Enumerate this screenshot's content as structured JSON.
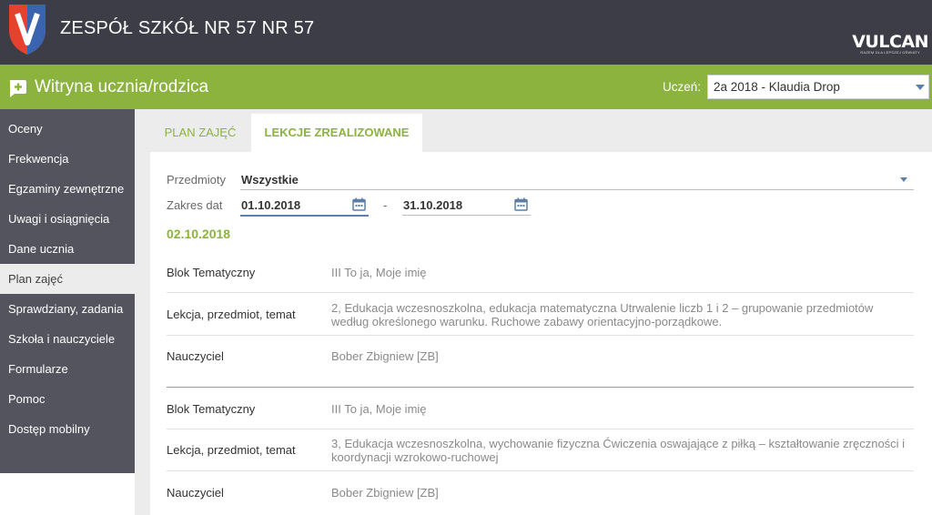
{
  "header": {
    "school_name": "ZESPÓŁ SZKÓŁ NR 57 NR 57",
    "vendor_logo": "VULCAN",
    "vendor_tagline": "RAZEM DLA LEPSZEJ OŚWIATY",
    "brand_color": "#8bb33e"
  },
  "app": {
    "title": "Witryna ucznia/rodzica",
    "student_label": "Uczeń:",
    "student_value": "2a 2018 - Klaudia Drop"
  },
  "sidebar": {
    "items": [
      {
        "label": "Oceny"
      },
      {
        "label": "Frekwencja"
      },
      {
        "label": "Egzaminy zewnętrzne"
      },
      {
        "label": "Uwagi i osiągnięcia"
      },
      {
        "label": "Dane ucznia"
      },
      {
        "label": "Plan zajęć",
        "active": true
      },
      {
        "label": "Sprawdziany, zadania"
      },
      {
        "label": "Szkoła i nauczyciele"
      },
      {
        "label": "Formularze"
      },
      {
        "label": "Pomoc"
      },
      {
        "label": "Dostęp mobilny"
      }
    ]
  },
  "tabs": [
    {
      "label": "PLAN ZAJĘĆ"
    },
    {
      "label": "LEKCJE ZREALIZOWANE",
      "active": true
    }
  ],
  "filters": {
    "subjects_label": "Przedmioty",
    "subjects_value": "Wszystkie",
    "date_range_label": "Zakres dat",
    "date_from": "01.10.2018",
    "date_separator": "-",
    "date_to": "31.10.2018"
  },
  "day": {
    "date": "02.10.2018",
    "lessons": [
      {
        "block_label": "Blok Tematyczny",
        "block_value": "III To ja, Moje imię",
        "lesson_label": "Lekcja, przedmiot, temat",
        "lesson_value": "2, Edukacja wczesnoszkolna, edukacja matematyczna Utrwalenie liczb 1 i 2 – grupowanie przedmiotów według określonego warunku. Ruchowe zabawy orientacyjno-porządkowe.",
        "teacher_label": "Nauczyciel",
        "teacher_value": "Bober Zbigniew [ZB]"
      },
      {
        "block_label": "Blok Tematyczny",
        "block_value": "III To ja, Moje imię",
        "lesson_label": "Lekcja, przedmiot, temat",
        "lesson_value": "3, Edukacja wczesnoszkolna, wychowanie fizyczna Ćwiczenia oswajające z piłką – kształtowanie zręczności i koordynacji wzrokowo-ruchowej",
        "teacher_label": "Nauczyciel",
        "teacher_value": "Bober Zbigniew [ZB]"
      }
    ]
  },
  "icons": {
    "school_crest": "shield-v-icon",
    "app": "chat-plus-icon",
    "dropdown": "caret-down-icon",
    "calendar": "calendar-icon"
  }
}
